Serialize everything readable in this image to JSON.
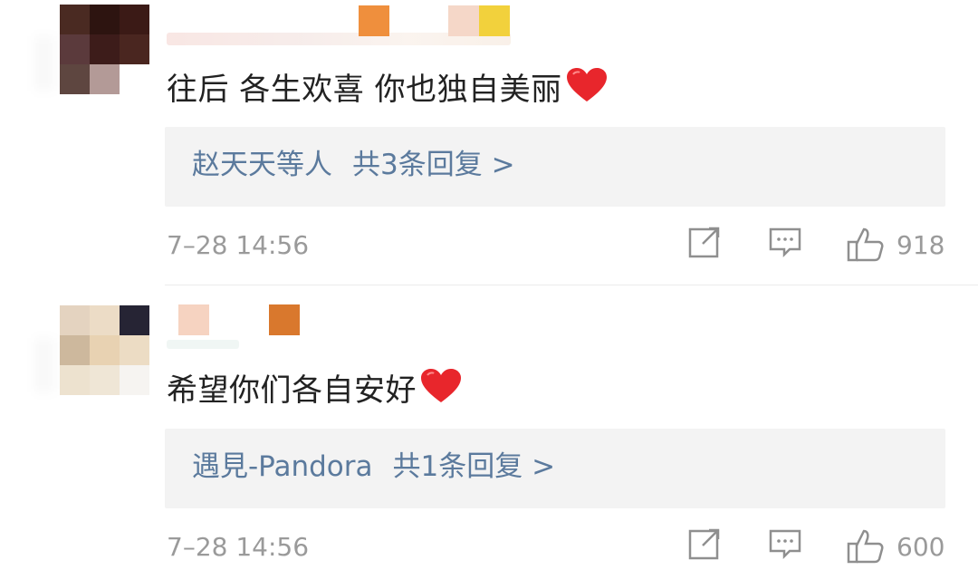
{
  "comments": [
    {
      "text": "往后 各生欢喜 你也独自美丽",
      "replies_names": "赵天天等人",
      "replies_count": "共3条回复 >",
      "time": "7–28 14:56",
      "likes": "918"
    },
    {
      "text": "希望你们各自安好",
      "replies_names": "遇見-Pandora",
      "replies_count": "共1条回复 >",
      "time": "7–28 14:56",
      "likes": "600"
    }
  ],
  "colors": {
    "link": "#5b7a9d",
    "meta": "#9a9a9a",
    "reply_bg": "#f3f3f3",
    "heart": "#e8262c"
  },
  "icons": [
    "share-icon",
    "comment-icon",
    "thumbs-up-icon",
    "heart-emoji"
  ]
}
